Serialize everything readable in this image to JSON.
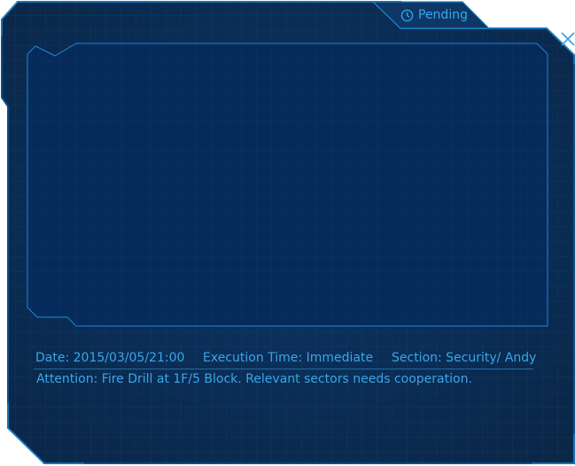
{
  "tab": {
    "icon": "clock-icon",
    "label": "Pending"
  },
  "close": {
    "icon": "close-icon"
  },
  "info": {
    "date": "Date: 2015/03/05/21:00",
    "execution_time": "Execution Time: Immediate",
    "section": "Section: Security/ Andy",
    "attention": "Attention: Fire Drill at 1F/5 Block. Relevant sectors needs cooperation."
  },
  "theme": {
    "background": "#0b2d57",
    "panel": "#062a5a",
    "border": "#1a8ad6",
    "text": "#3aa6e8"
  }
}
